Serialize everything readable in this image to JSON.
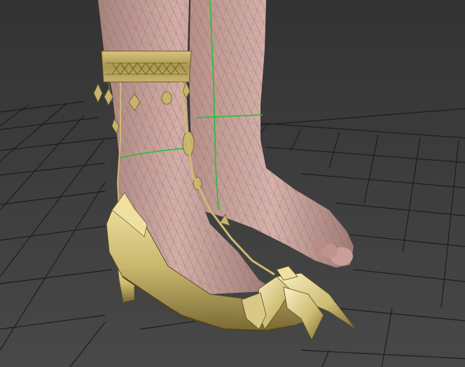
{
  "viewport": {
    "background_top": "#333333",
    "background_bottom": "#474747",
    "grid_color": "#1e1e1e",
    "skin_color": "#c9a39d",
    "wire_color": "#8f6e6a",
    "shoe_gold": "#c9b870",
    "shoe_highlight": "#f0e2a8",
    "shoe_shadow": "#6b5e2c",
    "seam_color": "#2fbf3a"
  }
}
